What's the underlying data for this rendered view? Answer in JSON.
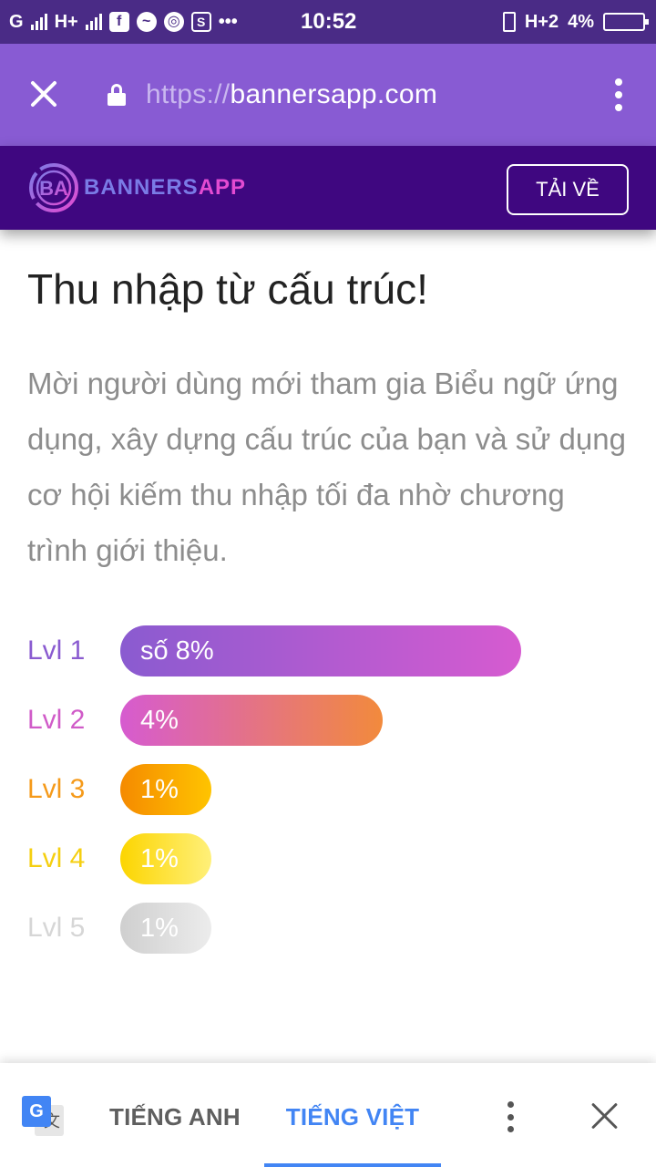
{
  "status_bar": {
    "carrier1": "G",
    "carrier2": "H+",
    "time": "10:52",
    "network_right": "H+2",
    "battery": "4%",
    "icons": [
      "signal-icon",
      "facebook-icon",
      "messenger-icon",
      "chrome-icon",
      "screenshot-icon",
      "more-dots-icon",
      "vibrate-icon",
      "battery-icon"
    ]
  },
  "browser": {
    "url_protocol": "https://",
    "url_host": "bannersapp.com"
  },
  "site_header": {
    "logo_text_a": "BANNERS",
    "logo_text_b": "APP",
    "logo_mark": "BA",
    "download_label": "TẢI VỀ"
  },
  "content": {
    "title": "Thu nhập từ cấu trúc!",
    "description": "Mời người dùng mới tham gia Biểu ngữ ứng dụng, xây dựng cấu trúc của bạn và sử dụng cơ hội kiếm thu nhập tối đa nhờ chương trình giới thiệu."
  },
  "levels": [
    {
      "label": "Lvl 1",
      "value": "số 8%",
      "percent": 8,
      "label_color": "#8a5bd0",
      "gradient": [
        "#8a5bd0",
        "#d65bd0"
      ]
    },
    {
      "label": "Lvl 2",
      "value": "4%",
      "percent": 4,
      "label_color": "#d05bc8",
      "gradient": [
        "#d65bd0",
        "#f28a3c"
      ]
    },
    {
      "label": "Lvl 3",
      "value": "1%",
      "percent": 1,
      "label_color": "#f59a1a",
      "gradient": [
        "#f58a00",
        "#ffc400"
      ]
    },
    {
      "label": "Lvl 4",
      "value": "1%",
      "percent": 1,
      "label_color": "#f5cf10",
      "gradient": [
        "#fcd500",
        "#fff07a"
      ]
    },
    {
      "label": "Lvl 5",
      "value": "1%",
      "percent": 1,
      "label_color": "#d6d6d6",
      "gradient": [
        "#cfcfcf",
        "#ececec"
      ]
    }
  ],
  "translate_bar": {
    "source_lang": "TIẾNG ANH",
    "target_lang": "TIẾNG VIỆT",
    "google_g": "G",
    "google_wen": "文"
  }
}
